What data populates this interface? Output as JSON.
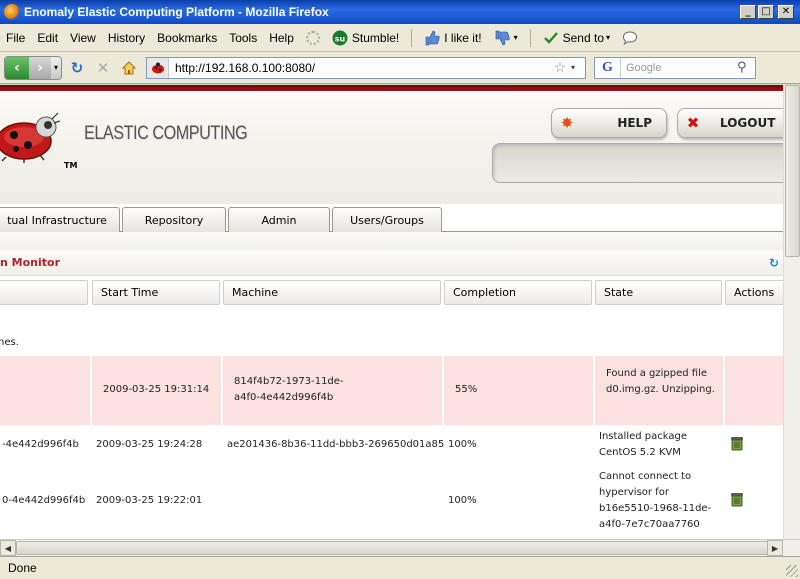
{
  "window": {
    "title": "Enomaly Elastic Computing Platform - Mozilla Firefox"
  },
  "menu": {
    "items": [
      "File",
      "Edit",
      "View",
      "History",
      "Bookmarks",
      "Tools",
      "Help"
    ],
    "stumble": "Stumble!",
    "like": "I like it!",
    "send_to": "Send to"
  },
  "nav": {
    "url": "http://192.168.0.100:8080/",
    "search_placeholder": "Google"
  },
  "header": {
    "brand": "ELASTIC COMPUTING",
    "tm": "TM",
    "help_label": "HELP",
    "logout_label": "LOGOUT"
  },
  "tabs": [
    "tual Infrastructure",
    "Repository",
    "Admin",
    "Users/Groups"
  ],
  "section": {
    "title": "n Monitor"
  },
  "table": {
    "columns": [
      "",
      "Start Time",
      "Machine",
      "Completion",
      "State",
      "Actions"
    ],
    "message": "hes.",
    "rows": [
      {
        "id": "",
        "start": "2009-03-25 19:31:14",
        "machine": "814f4b72-1973-11de-a4f0-4e442d996f4b",
        "completion": "55%",
        "state": "Found a gzipped file d0.img.gz. Unzipping."
      },
      {
        "id": "-4e442d996f4b",
        "start": "2009-03-25 19:24:28",
        "machine": "ae201436-8b36-11dd-bbb3-269650d01a85",
        "completion": "100%",
        "state": "Installed package CentOS 5.2 KVM"
      },
      {
        "id": "0-4e442d996f4b",
        "start": "2009-03-25 19:22:01",
        "machine": "",
        "completion": "100%",
        "state": "Cannot connect to hypervisor for b16e5510-1968-11de-a4f0-7e7c70aa7760"
      }
    ]
  },
  "status": {
    "text": "Done"
  }
}
